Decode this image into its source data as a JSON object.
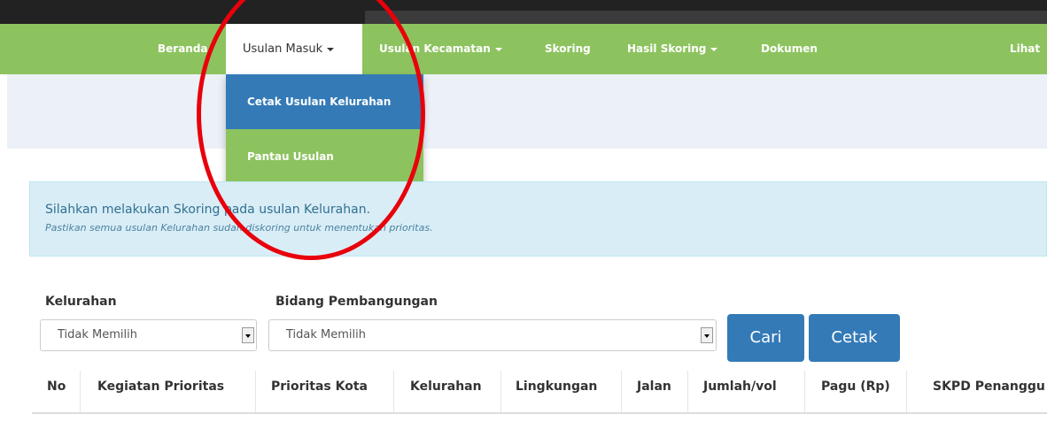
{
  "navbar": {
    "items": [
      {
        "label": "Beranda"
      },
      {
        "label": "Usulan Masuk"
      },
      {
        "label": "Usulan Kecamatan"
      },
      {
        "label": "Skoring"
      },
      {
        "label": "Hasil Skoring"
      },
      {
        "label": "Dokumen"
      },
      {
        "label": "Lihat"
      }
    ]
  },
  "dropdown": {
    "items": [
      {
        "label": "Cetak Usulan Kelurahan"
      },
      {
        "label": "Pantau Usulan"
      }
    ]
  },
  "alert": {
    "main": "Silahkan melakukan Skoring pada usulan Kelurahan.",
    "sub": "Pastikan semua usulan Kelurahan sudah diskoring untuk menentukan prioritas."
  },
  "filters": {
    "kelurahan_label": "Kelurahan",
    "kelurahan_value": "Tidak Memilih",
    "bidang_label": "Bidang Pembangungan",
    "bidang_value": "Tidak Memilih",
    "search_button": "Cari",
    "print_button": "Cetak"
  },
  "table": {
    "columns": [
      "No",
      "Kegiatan Prioritas",
      "Prioritas Kota",
      "Kelurahan",
      "Lingkungan",
      "Jalan",
      "Jumlah/vol",
      "Pagu (Rp)",
      "SKPD Penanggu"
    ]
  },
  "colors": {
    "navbar_green": "#8dc35f",
    "active_blue": "#337ab7",
    "annotation_red": "#e8000b"
  }
}
